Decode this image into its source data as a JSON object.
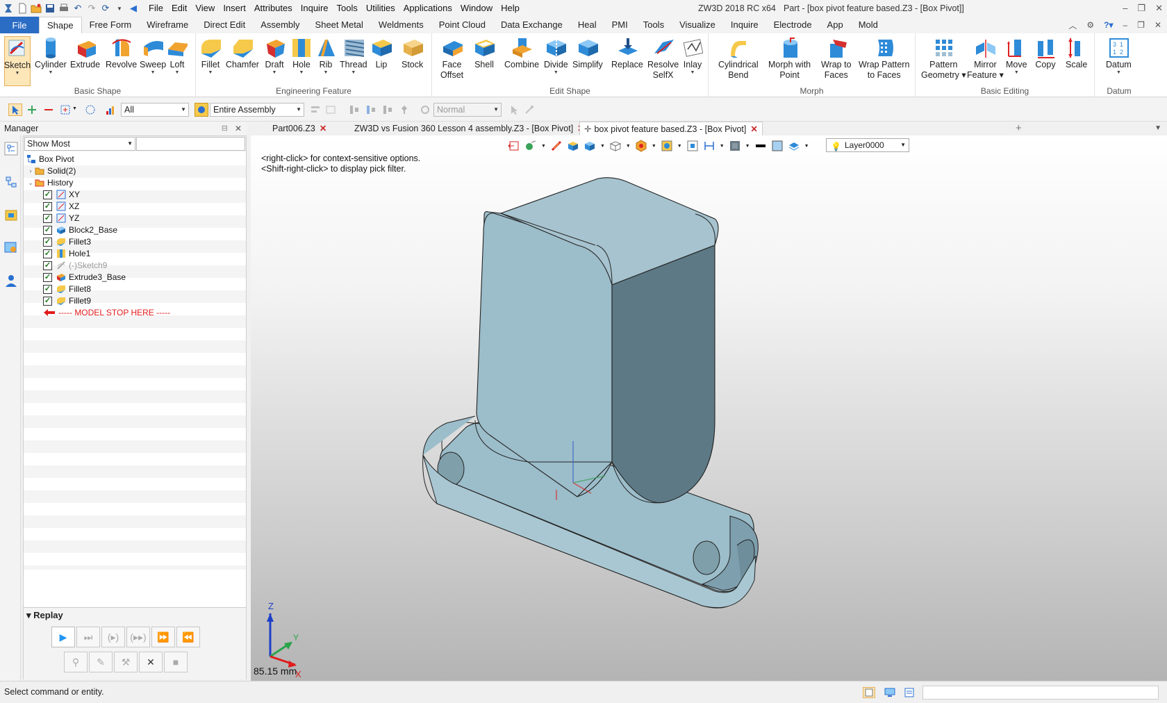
{
  "title_bar": {
    "menus": [
      "File",
      "Edit",
      "View",
      "Insert",
      "Attributes",
      "Inquire",
      "Tools",
      "Utilities",
      "Applications",
      "Window",
      "Help"
    ],
    "app_name": "ZW3D 2018 RC x64",
    "doc_title": "Part - [box pivot feature based.Z3 - [Box Pivot]]"
  },
  "ribbon_tabs": {
    "file": "File",
    "tabs": [
      "Shape",
      "Free Form",
      "Wireframe",
      "Direct Edit",
      "Assembly",
      "Sheet Metal",
      "Weldments",
      "Point Cloud",
      "Data Exchange",
      "Heal",
      "PMI",
      "Tools",
      "Visualize",
      "Inquire",
      "Electrode",
      "App",
      "Mold"
    ],
    "active": "Shape"
  },
  "ribbon_groups": {
    "basic_shape": {
      "label": "Basic Shape",
      "tools": {
        "sketch": "Sketch",
        "cylinder": "Cylinder",
        "extrude": "Extrude",
        "revolve": "Revolve",
        "sweep": "Sweep",
        "loft": "Loft"
      }
    },
    "engineering_feature": {
      "label": "Engineering Feature",
      "tools": {
        "fillet": "Fillet",
        "chamfer": "Chamfer",
        "draft": "Draft",
        "hole": "Hole",
        "rib": "Rib",
        "thread": "Thread",
        "lip": "Lip",
        "stock": "Stock"
      }
    },
    "edit_shape": {
      "label": "Edit Shape",
      "tools": {
        "face_offset_1": "Face",
        "face_offset_2": "Offset",
        "shell": "Shell",
        "combine": "Combine",
        "divide": "Divide",
        "simplify": "Simplify",
        "replace": "Replace",
        "resolve_1": "Resolve",
        "resolve_2": "SelfX",
        "inlay": "Inlay"
      }
    },
    "morph": {
      "label": "Morph",
      "tools": {
        "cyl_bend_1": "Cylindrical",
        "cyl_bend_2": "Bend",
        "morph_point_1": "Morph with",
        "morph_point_2": "Point",
        "wrap_faces_1": "Wrap to",
        "wrap_faces_2": "Faces",
        "wrap_pattern_1": "Wrap Pattern",
        "wrap_pattern_2": "to Faces"
      }
    },
    "basic_editing": {
      "label": "Basic Editing",
      "tools": {
        "pattern_1": "Pattern",
        "pattern_2": "Geometry",
        "mirror_1": "Mirror",
        "mirror_2": "Feature",
        "move": "Move",
        "copy": "Copy",
        "scale": "Scale"
      }
    },
    "datum": {
      "label": "Datum",
      "tools": {
        "datum": "Datum"
      }
    }
  },
  "toolbar2": {
    "filter_value": "All",
    "scope_value": "Entire Assembly",
    "mode_value": "Normal"
  },
  "manager": {
    "title": "Manager",
    "filter_value": "Show Most",
    "tree": {
      "root": "Box Pivot",
      "solid": "Solid(2)",
      "history": "History",
      "items": [
        "XY",
        "XZ",
        "YZ",
        "Block2_Base",
        "Fillet3",
        "Hole1",
        "(-)Sketch9",
        "Extrude3_Base",
        "Fillet8",
        "Fillet9"
      ],
      "stop_marker": "----- MODEL STOP HERE -----"
    },
    "replay_label": "Replay"
  },
  "doc_tabs": [
    "Part006.Z3",
    "ZW3D vs Fusion 360 Lesson 4 assembly.Z3 - [Box Pivot]",
    "box pivot feature based.Z3 - [Box Pivot]"
  ],
  "viewport": {
    "layer": "Layer0000",
    "hint_1": "<right-click> for context-sensitive options.",
    "hint_2": "<Shift-right-click> to display pick filter.",
    "measurement": "85.15 mm",
    "triad": {
      "x": "X",
      "y": "Y",
      "z": "Z"
    }
  },
  "status": {
    "text": "Select command or entity."
  },
  "colors": {
    "file_tab": "#2b6cc4",
    "model_light": "#9fbfcc",
    "model_dark": "#5e7b87",
    "stop_marker": "#e01b1b"
  }
}
